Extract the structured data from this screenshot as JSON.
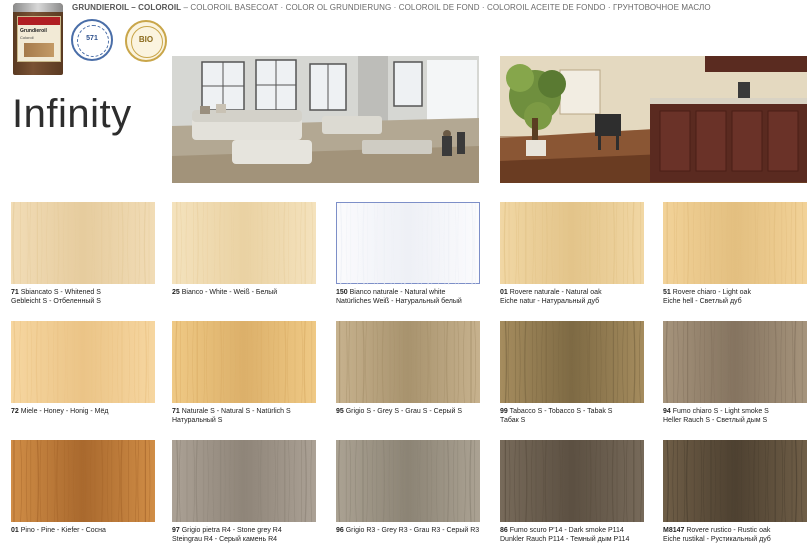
{
  "header": {
    "line_bold": "GRUNDIEROIL – COLOROIL",
    "line_rest": " – COLOROIL BASECOAT · COLOR OL GRUNDIERUNG · COLOROIL DE FOND · COLOROIL ACEITE DE FONDO · ГРУНТОВОЧНОЕ МАСЛО"
  },
  "product": {
    "can_line1": "Grundieroil",
    "can_line2": "Coloroil",
    "seal1_text": "571",
    "seal2_text": "BIO"
  },
  "title": "Infinity",
  "swatches": [
    {
      "code": "71",
      "line1": "Sbiancato S - Whitened S",
      "line2": "Gebleicht S - Отбеленный S",
      "color": "#f1dcb6",
      "color2": "#e6cc9e",
      "selected": false
    },
    {
      "code": "25",
      "line1": "Bianco - White - Weiß - Белый",
      "line2": "",
      "color": "#f4e2bd",
      "color2": "#ead2a3",
      "selected": false
    },
    {
      "code": "150",
      "line1": "Bianco naturale - Natural white",
      "line2": "Natürliches Weiß - Натуральный белый",
      "color": "#fbfbfd",
      "color2": "#eef0f6",
      "selected": true
    },
    {
      "code": "01",
      "line1": "Rovere naturale - Natural oak",
      "line2": "Eiche natur - Натуральный дуб",
      "color": "#f1d7a4",
      "color2": "#e3c48a",
      "selected": false
    },
    {
      "code": "51",
      "line1": "Rovere chiaro - Light oak",
      "line2": "Eiche hell - Светлый дуб",
      "color": "#f2d298",
      "color2": "#e3bf80",
      "selected": false
    },
    {
      "code": "72",
      "line1": "Miele - Honey - Honig - Мёд",
      "line2": "",
      "color": "#f6d6a0",
      "color2": "#ebc487",
      "selected": false
    },
    {
      "code": "71",
      "line1": "Naturale S - Natural S - Natürlich S",
      "line2": "Натуральный S",
      "color": "#efc985",
      "color2": "#dcb06a",
      "selected": false
    },
    {
      "code": "95",
      "line1": "Grigio S - Grey S - Grau S - Серый S",
      "line2": "",
      "color": "#c7b28e",
      "color2": "#a8936e",
      "selected": false
    },
    {
      "code": "99",
      "line1": "Tabacco S - Tobacco S - Tabak S",
      "line2": "Табак S",
      "color": "#a58c5e",
      "color2": "#7e6a44",
      "selected": false
    },
    {
      "code": "94",
      "line1": "Fumo chiaro S - Light smoke S",
      "line2": "Heller Rauch S - Светлый дым S",
      "color": "#a6947c",
      "color2": "#857460",
      "selected": false
    },
    {
      "code": "01",
      "line1": "Pino - Pine - Kiefer - Сосна",
      "line2": "",
      "color": "#d08d46",
      "color2": "#a9692e",
      "selected": false
    },
    {
      "code": "97",
      "line1": "Grigio pietra R4 - Stone grey R4",
      "line2": "Steingrau R4 - Серый камень R4",
      "color": "#aba195",
      "color2": "#8f8579",
      "selected": false
    },
    {
      "code": "96",
      "line1": "Grigio R3 - Grey R3 - Grau R3 - Серый R3",
      "line2": "",
      "color": "#aba293",
      "color2": "#8c8475",
      "selected": false
    },
    {
      "code": "86",
      "line1": "Fumo scuro P'14 - Dark smoke P114",
      "line2": "Dunkler Rauch P114 - Темный дым P114",
      "color": "#776a5a",
      "color2": "#5c5042",
      "selected": false
    },
    {
      "code": "M8147",
      "line1": "Rovere rustico - Rustic oak",
      "line2": "Eiche rustikal - Рустикальный дуб",
      "color": "#6f5e47",
      "color2": "#4e4131",
      "selected": false
    }
  ]
}
